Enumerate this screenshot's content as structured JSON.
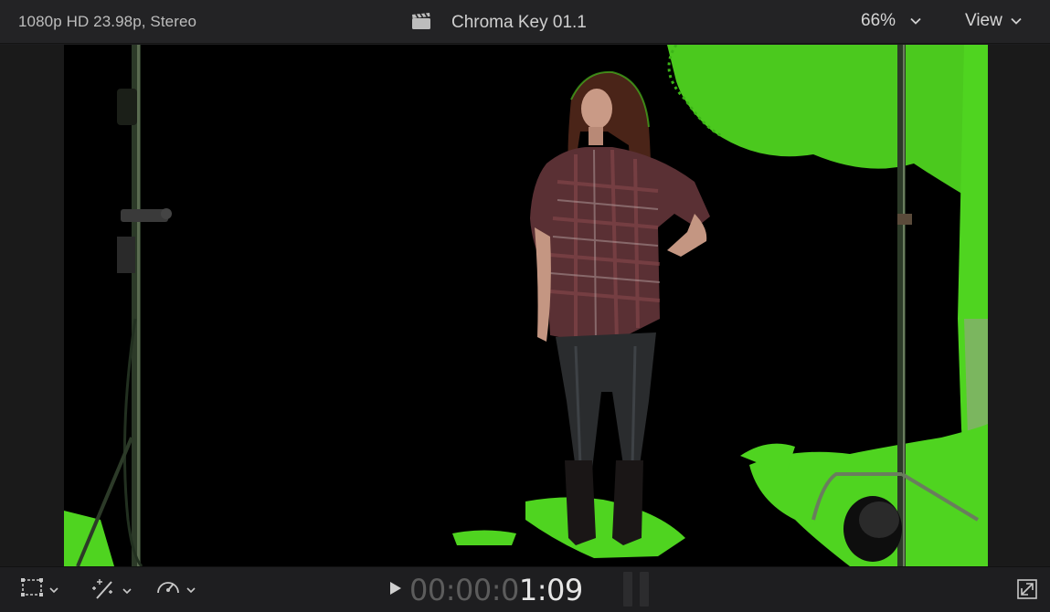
{
  "header": {
    "format_info": "1080p HD 23.98p, Stereo",
    "clip_icon": "clapperboard-icon",
    "clip_title": "Chroma Key 01.1",
    "zoom_value": "66%",
    "view_label": "View"
  },
  "viewer": {
    "key_color": "#4fd420",
    "frame_background": "#000000"
  },
  "footer": {
    "tools": [
      "transform-menu-icon",
      "enhance-wand-icon",
      "retime-speed-icon"
    ],
    "timecode_dim": "00:00:0",
    "timecode_bright": "1:09",
    "fullscreen_icon": "fullscreen-icon"
  }
}
